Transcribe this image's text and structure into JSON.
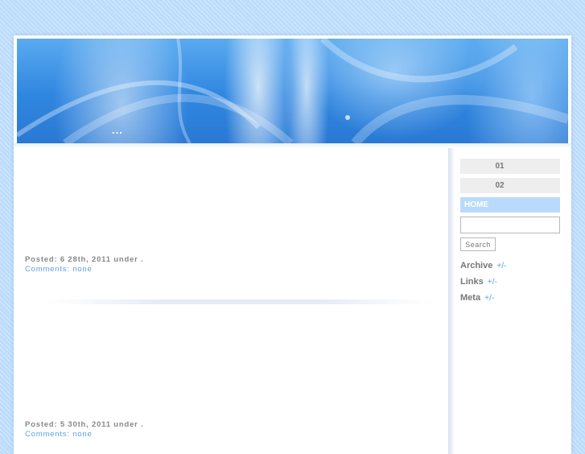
{
  "header": {
    "title": "..."
  },
  "posts": [
    {
      "meta": "Posted: 6   28th, 2011 under    .",
      "comments_label": "Comments:",
      "comments_link": "none"
    },
    {
      "meta": "Posted: 5   30th, 2011 under    .",
      "comments_label": "Comments:",
      "comments_link": "none"
    }
  ],
  "sidebar": {
    "nav": [
      "01",
      "02",
      "HOME"
    ],
    "search": {
      "value": "",
      "button_label": "Search"
    },
    "widgets": [
      {
        "title": "Archive",
        "toggle": "+/-"
      },
      {
        "title": "Links",
        "toggle": "+/-"
      },
      {
        "title": "Meta",
        "toggle": "+/-"
      }
    ]
  },
  "colors": {
    "page_background": "#bcdcfb",
    "header_blue": "#2f86e0",
    "link": "#5a9ee8",
    "active_nav": "#b9dafb",
    "nav_background": "#eeeeee"
  }
}
